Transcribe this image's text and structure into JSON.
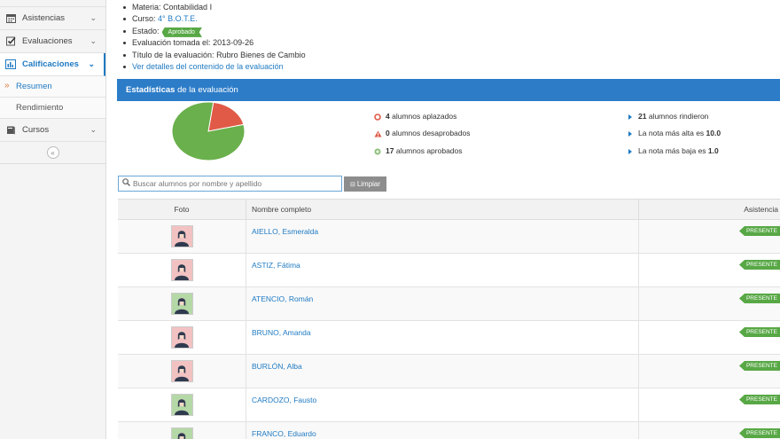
{
  "sidebar": {
    "items": [
      {
        "label": "Asistencias",
        "icon": "calendar-icon"
      },
      {
        "label": "Evaluaciones",
        "icon": "checkbox-icon"
      },
      {
        "label": "Calificaciones",
        "icon": "bar-chart-icon"
      },
      {
        "label": "Cursos",
        "icon": "book-icon"
      }
    ],
    "subitems": [
      {
        "label": "Resumen"
      },
      {
        "label": "Rendimiento"
      }
    ],
    "collapse_glyph": "«"
  },
  "info": {
    "materia_label": "Materia:",
    "materia_value": "Contabilidad I",
    "curso_label": "Curso:",
    "curso_value": "4° B.O.T.E.",
    "estado_label": "Estado:",
    "estado_value": "Aprobado",
    "fecha_label": "Evaluación tomada el:",
    "fecha_value": "2013-09-26",
    "titulo_label": "Título de la evaluación:",
    "titulo_value": "Rubro Bienes de Cambio",
    "details_link": "Ver detalles del contenido de la evaluación"
  },
  "stats": {
    "header_bold": "Estadísticas",
    "header_rest": "de la evaluación",
    "left": [
      {
        "count": "4",
        "text": "alumnos aplazados"
      },
      {
        "count": "0",
        "text": "alumnos desaprobados"
      },
      {
        "count": "17",
        "text": "alumnos aprobados"
      }
    ],
    "right": [
      {
        "lead": "",
        "bold": "21",
        "text": " alumnos rindieron"
      },
      {
        "lead": "La nota más alta es ",
        "bold": "10.0",
        "text": ""
      },
      {
        "lead": "La nota más baja es ",
        "bold": "1.0",
        "text": ""
      }
    ],
    "colors": {
      "approved": "#6ab04c",
      "failed": "#e05a47",
      "accent": "#2c7cc8"
    }
  },
  "chart_data": {
    "type": "pie",
    "categories": [
      "alumnos aplazados",
      "alumnos desaprobados",
      "alumnos aprobados"
    ],
    "values": [
      4,
      0,
      17
    ]
  },
  "search": {
    "placeholder": "Buscar alumnos por nombre y apellido",
    "clear_label": "Limpiar"
  },
  "table": {
    "headers": {
      "foto": "Foto",
      "nombre": "Nombre completo",
      "asistencia": "Asistencia"
    },
    "rows": [
      {
        "name": "AIELLO, Esmeralda",
        "gender": "f",
        "status": "PRESENTE"
      },
      {
        "name": "ASTIZ, Fátima",
        "gender": "f",
        "status": "PRESENTE"
      },
      {
        "name": "ATENCIO, Román",
        "gender": "m",
        "status": "PRESENTE"
      },
      {
        "name": "BRUNO, Amanda",
        "gender": "f",
        "status": "PRESENTE"
      },
      {
        "name": "BURLÓN, Alba",
        "gender": "f",
        "status": "PRESENTE"
      },
      {
        "name": "CARDOZO, Fausto",
        "gender": "m",
        "status": "PRESENTE"
      },
      {
        "name": "FRANCO, Eduardo",
        "gender": "m",
        "status": "PRESENTE"
      }
    ]
  }
}
